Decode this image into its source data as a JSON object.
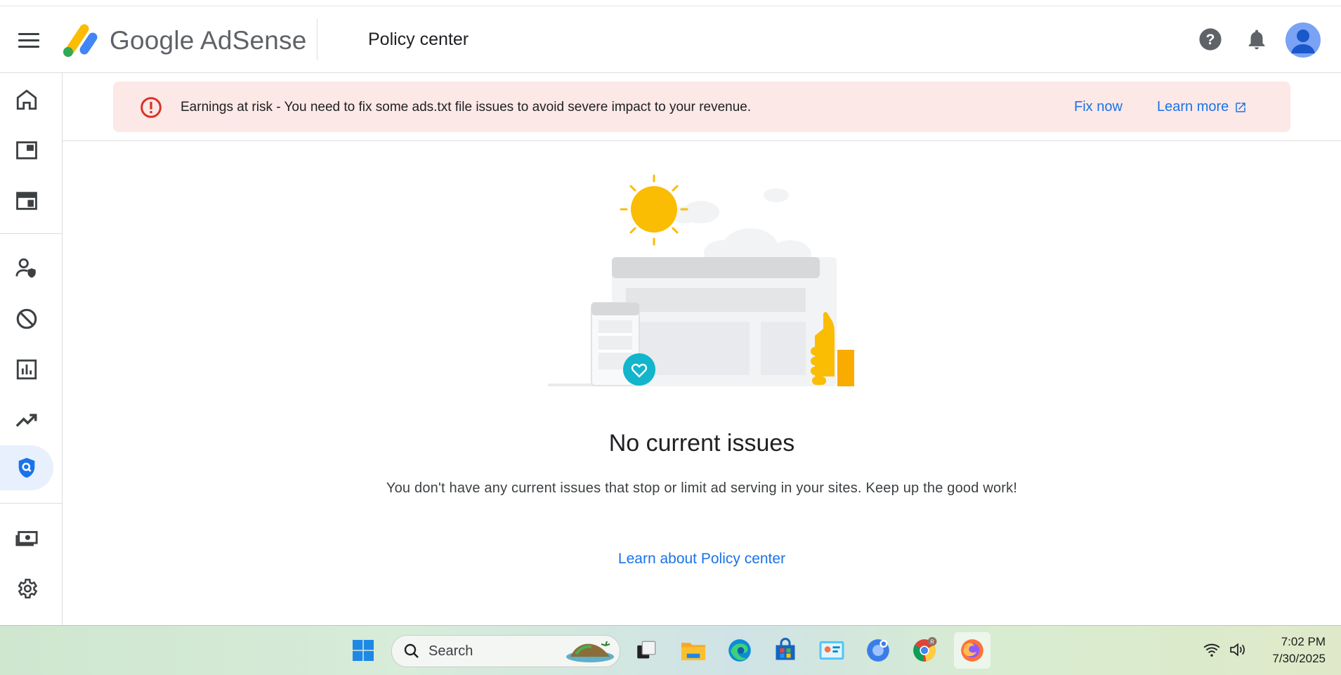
{
  "app": {
    "brand": "Google AdSense",
    "brand_google": "Google",
    "brand_product": "AdSense",
    "page_title": "Policy center",
    "accent_color": "#1a73e8"
  },
  "header": {
    "icons": [
      "menu-icon",
      "help-icon",
      "notifications-icon",
      "avatar"
    ]
  },
  "sidebar": {
    "items": [
      {
        "name": "home",
        "icon": "home-icon",
        "active": false
      },
      {
        "name": "ads",
        "icon": "ads-icon",
        "active": false
      },
      {
        "name": "content",
        "icon": "content-icon",
        "active": false
      },
      {
        "name": "privacy-messaging",
        "icon": "privacy-icon",
        "active": false
      },
      {
        "name": "blocking-controls",
        "icon": "block-icon",
        "active": false
      },
      {
        "name": "reports",
        "icon": "reports-icon",
        "active": false
      },
      {
        "name": "optimization",
        "icon": "trending-icon",
        "active": false
      },
      {
        "name": "policy-center",
        "icon": "policy-shield-icon",
        "active": true
      },
      {
        "name": "payments",
        "icon": "payments-icon",
        "active": false
      },
      {
        "name": "settings",
        "icon": "settings-icon",
        "active": false
      }
    ]
  },
  "banner": {
    "message": "Earnings at risk - You need to fix some ads.txt file issues to avoid severe impact to your revenue.",
    "fix_label": "Fix now",
    "learn_label": "Learn more",
    "background_color": "#fce8e6",
    "icon_color": "#d93025"
  },
  "main": {
    "title": "No current issues",
    "description": "You don't have any current issues that stop or limit ad serving in your sites. Keep up the good work!",
    "link_label": "Learn about Policy center"
  },
  "taskbar": {
    "search_placeholder": "Search",
    "time": "7:02 PM",
    "date": "7/30/2025",
    "apps": [
      "windows-start-icon",
      "task-view-icon",
      "file-explorer-icon",
      "edge-icon",
      "store-icon",
      "widgets-icon",
      "copilot-icon",
      "chrome-icon",
      "firefox-icon"
    ]
  }
}
